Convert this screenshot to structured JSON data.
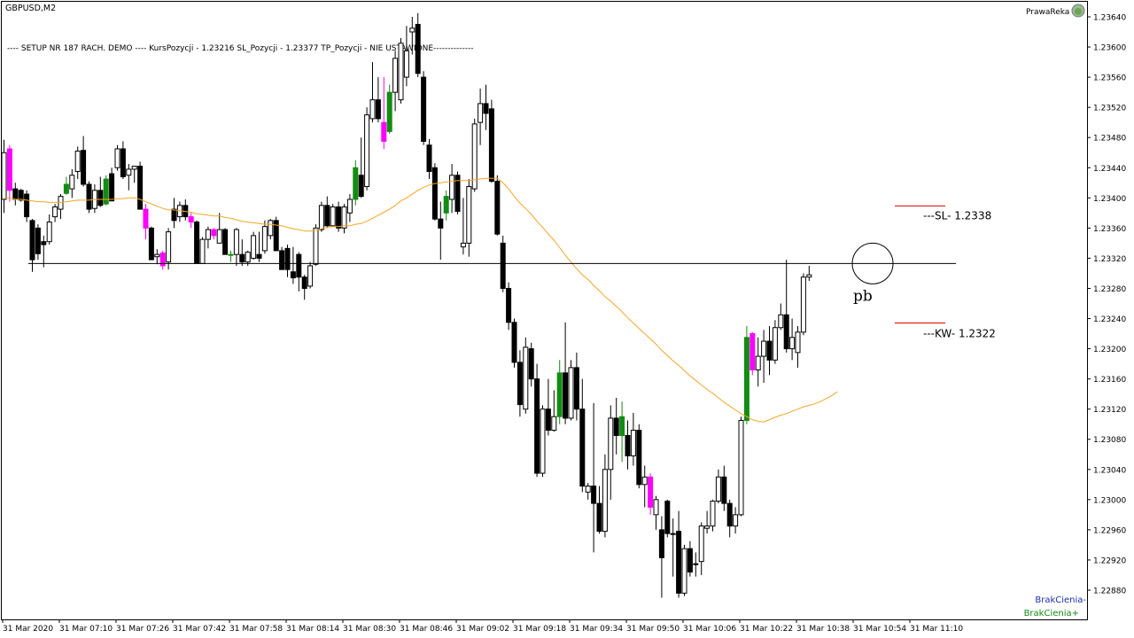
{
  "window": {
    "title": "GBPUSD,M2",
    "robot_name": "PrawaReka"
  },
  "chart_data": {
    "type": "candlestick",
    "symbol": "GBPUSD",
    "timeframe": "M2",
    "info_text": "---- SETUP NR 187 RACH. DEMO ---- KursPozycji - 1.23216 SL_Pozycji - 1.23377  TP_Pozycji - NIE USTAWIONE--------------",
    "y_ticks": [
      "1.23640",
      "1.23600",
      "1.23560",
      "1.23520",
      "1.23480",
      "1.23440",
      "1.23400",
      "1.23360",
      "1.23320",
      "1.23280",
      "1.23240",
      "1.23200",
      "1.23160",
      "1.23120",
      "1.23080",
      "1.23040",
      "1.23000",
      "1.22960",
      "1.22920",
      "1.22880"
    ],
    "ylim": [
      1.22865,
      1.23655
    ],
    "x_ticks": [
      "31 Mar 2020",
      "31 Mar 07:10",
      "31 Mar 07:26",
      "31 Mar 07:42",
      "31 Mar 07:58",
      "31 Mar 08:14",
      "31 Mar 08:30",
      "31 Mar 08:46",
      "31 Mar 09:02",
      "31 Mar 09:18",
      "31 Mar 09:34",
      "31 Mar 09:50",
      "31 Mar 10:06",
      "31 Mar 10:22",
      "31 Mar 10:38",
      "31 Mar 10:54",
      "31 Mar 11:10"
    ],
    "level_line": 1.23313,
    "sl_label": "---SL- 1.2338",
    "sl_level": 1.2338,
    "kw_label": "---KW- 1.2322",
    "kw_level": 1.2322,
    "annotation": "pb",
    "legend": {
      "line1": "BrakCienia-",
      "line2": "BrakCienia+"
    },
    "colors": {
      "bull": "#ffffff",
      "bear": "#000000",
      "outline": "#000000",
      "no_wick_down": "#ff00ff",
      "no_wick_up": "#128c12",
      "ma": "#f5a623",
      "sl_line": "#dd0000",
      "kw_line": "#dd0000",
      "legend_minus": "#1b2fae",
      "legend_plus": "#128c12"
    },
    "candles": [
      {
        "o": 1.23398,
        "h": 1.23477,
        "l": 1.2338,
        "c": 1.2346
      },
      {
        "o": 1.23465,
        "h": 1.2347,
        "l": 1.23395,
        "c": 1.2341
      },
      {
        "o": 1.23412,
        "h": 1.2342,
        "l": 1.2339,
        "c": 1.23398
      },
      {
        "o": 1.2341,
        "h": 1.23412,
        "l": 1.23395,
        "c": 1.23397
      },
      {
        "o": 1.23405,
        "h": 1.2341,
        "l": 1.23368,
        "c": 1.23375
      },
      {
        "o": 1.2337,
        "h": 1.23372,
        "l": 1.23302,
        "c": 1.23318
      },
      {
        "o": 1.2336,
        "h": 1.23365,
        "l": 1.23318,
        "c": 1.23326
      },
      {
        "o": 1.23342,
        "h": 1.2335,
        "l": 1.23308,
        "c": 1.23338
      },
      {
        "o": 1.23342,
        "h": 1.23378,
        "l": 1.23338,
        "c": 1.23368
      },
      {
        "o": 1.23375,
        "h": 1.23392,
        "l": 1.23368,
        "c": 1.23388
      },
      {
        "o": 1.23385,
        "h": 1.23405,
        "l": 1.23372,
        "c": 1.23402
      },
      {
        "o": 1.23406,
        "h": 1.23428,
        "l": 1.23404,
        "c": 1.23418
      },
      {
        "o": 1.23412,
        "h": 1.23438,
        "l": 1.234,
        "c": 1.2343
      },
      {
        "o": 1.23435,
        "h": 1.23468,
        "l": 1.23425,
        "c": 1.23462
      },
      {
        "o": 1.23463,
        "h": 1.23482,
        "l": 1.23415,
        "c": 1.23418
      },
      {
        "o": 1.23418,
        "h": 1.23422,
        "l": 1.2338,
        "c": 1.23385
      },
      {
        "o": 1.23386,
        "h": 1.23418,
        "l": 1.2338,
        "c": 1.2341
      },
      {
        "o": 1.2341,
        "h": 1.23428,
        "l": 1.23388,
        "c": 1.2339
      },
      {
        "o": 1.23392,
        "h": 1.2343,
        "l": 1.2339,
        "c": 1.23425
      },
      {
        "o": 1.23432,
        "h": 1.2344,
        "l": 1.23396,
        "c": 1.23396
      },
      {
        "o": 1.2344,
        "h": 1.2347,
        "l": 1.23436,
        "c": 1.23465
      },
      {
        "o": 1.23465,
        "h": 1.23475,
        "l": 1.23425,
        "c": 1.23428
      },
      {
        "o": 1.2343,
        "h": 1.23445,
        "l": 1.2341,
        "c": 1.23438
      },
      {
        "o": 1.23438,
        "h": 1.23442,
        "l": 1.2342,
        "c": 1.23442
      },
      {
        "o": 1.23442,
        "h": 1.23448,
        "l": 1.23385,
        "c": 1.23385
      },
      {
        "o": 1.23385,
        "h": 1.23392,
        "l": 1.23345,
        "c": 1.2336
      },
      {
        "o": 1.2336,
        "h": 1.23362,
        "l": 1.23318,
        "c": 1.23318
      },
      {
        "o": 1.23322,
        "h": 1.23332,
        "l": 1.23312,
        "c": 1.23325
      },
      {
        "o": 1.23327,
        "h": 1.2333,
        "l": 1.23305,
        "c": 1.2331
      },
      {
        "o": 1.23315,
        "h": 1.2336,
        "l": 1.23305,
        "c": 1.23355
      },
      {
        "o": 1.23385,
        "h": 1.234,
        "l": 1.2336,
        "c": 1.2337
      },
      {
        "o": 1.23375,
        "h": 1.23395,
        "l": 1.23368,
        "c": 1.2339
      },
      {
        "o": 1.2339,
        "h": 1.23398,
        "l": 1.2337,
        "c": 1.23375
      },
      {
        "o": 1.23375,
        "h": 1.2338,
        "l": 1.2336,
        "c": 1.23368
      },
      {
        "o": 1.23368,
        "h": 1.2337,
        "l": 1.23313,
        "c": 1.23313
      },
      {
        "o": 1.23313,
        "h": 1.23348,
        "l": 1.23313,
        "c": 1.23345
      },
      {
        "o": 1.23345,
        "h": 1.23362,
        "l": 1.23333,
        "c": 1.23358
      },
      {
        "o": 1.23358,
        "h": 1.2336,
        "l": 1.23345,
        "c": 1.2335
      },
      {
        "o": 1.2334,
        "h": 1.2338,
        "l": 1.2334,
        "c": 1.23358
      },
      {
        "o": 1.23358,
        "h": 1.2336,
        "l": 1.23325,
        "c": 1.23325
      },
      {
        "o": 1.23325,
        "h": 1.2333,
        "l": 1.23315,
        "c": 1.23325
      },
      {
        "o": 1.23325,
        "h": 1.2336,
        "l": 1.2331,
        "c": 1.23358
      },
      {
        "o": 1.23325,
        "h": 1.23345,
        "l": 1.2331,
        "c": 1.23315
      },
      {
        "o": 1.23315,
        "h": 1.2333,
        "l": 1.2331,
        "c": 1.23328
      },
      {
        "o": 1.2332,
        "h": 1.23355,
        "l": 1.23318,
        "c": 1.2335
      },
      {
        "o": 1.23325,
        "h": 1.23355,
        "l": 1.23315,
        "c": 1.2332
      },
      {
        "o": 1.2333,
        "h": 1.2337,
        "l": 1.23326,
        "c": 1.23362
      },
      {
        "o": 1.2335,
        "h": 1.23372,
        "l": 1.23345,
        "c": 1.2337
      },
      {
        "o": 1.2337,
        "h": 1.23375,
        "l": 1.2333,
        "c": 1.2333
      },
      {
        "o": 1.2333,
        "h": 1.23335,
        "l": 1.23305,
        "c": 1.23305
      },
      {
        "o": 1.23333,
        "h": 1.23338,
        "l": 1.23295,
        "c": 1.23305
      },
      {
        "o": 1.23302,
        "h": 1.23335,
        "l": 1.23286,
        "c": 1.23294
      },
      {
        "o": 1.23325,
        "h": 1.23328,
        "l": 1.23276,
        "c": 1.23295
      },
      {
        "o": 1.23295,
        "h": 1.23298,
        "l": 1.23265,
        "c": 1.2328
      },
      {
        "o": 1.23283,
        "h": 1.23315,
        "l": 1.2328,
        "c": 1.2331
      },
      {
        "o": 1.23312,
        "h": 1.23365,
        "l": 1.2331,
        "c": 1.2336
      },
      {
        "o": 1.23358,
        "h": 1.23395,
        "l": 1.23355,
        "c": 1.2339
      },
      {
        "o": 1.2339,
        "h": 1.23402,
        "l": 1.2336,
        "c": 1.23363
      },
      {
        "o": 1.23363,
        "h": 1.23392,
        "l": 1.23362,
        "c": 1.23388
      },
      {
        "o": 1.23388,
        "h": 1.23395,
        "l": 1.23355,
        "c": 1.2336
      },
      {
        "o": 1.2336,
        "h": 1.23392,
        "l": 1.23353,
        "c": 1.23388
      },
      {
        "o": 1.2338,
        "h": 1.23405,
        "l": 1.23368,
        "c": 1.23398
      },
      {
        "o": 1.23398,
        "h": 1.2345,
        "l": 1.2339,
        "c": 1.2344
      },
      {
        "o": 1.2343,
        "h": 1.2348,
        "l": 1.234,
        "c": 1.23402
      },
      {
        "o": 1.23415,
        "h": 1.2352,
        "l": 1.2341,
        "c": 1.2351
      },
      {
        "o": 1.23505,
        "h": 1.2358,
        "l": 1.235,
        "c": 1.2353
      },
      {
        "o": 1.2353,
        "h": 1.2356,
        "l": 1.235,
        "c": 1.23505
      },
      {
        "o": 1.235,
        "h": 1.2356,
        "l": 1.23465,
        "c": 1.23475
      },
      {
        "o": 1.23488,
        "h": 1.2355,
        "l": 1.23485,
        "c": 1.2354
      },
      {
        "o": 1.2354,
        "h": 1.23595,
        "l": 1.23515,
        "c": 1.23585
      },
      {
        "o": 1.2353,
        "h": 1.23612,
        "l": 1.23525,
        "c": 1.23605
      },
      {
        "o": 1.2356,
        "h": 1.23628,
        "l": 1.23548,
        "c": 1.23595
      },
      {
        "o": 1.2362,
        "h": 1.2364,
        "l": 1.2359,
        "c": 1.23625
      },
      {
        "o": 1.2363,
        "h": 1.23645,
        "l": 1.2356,
        "c": 1.23565
      },
      {
        "o": 1.2356,
        "h": 1.23568,
        "l": 1.2347,
        "c": 1.23475
      },
      {
        "o": 1.2347,
        "h": 1.23478,
        "l": 1.23425,
        "c": 1.23435
      },
      {
        "o": 1.2344,
        "h": 1.23446,
        "l": 1.2337,
        "c": 1.23372
      },
      {
        "o": 1.23372,
        "h": 1.23395,
        "l": 1.23318,
        "c": 1.2336
      },
      {
        "o": 1.2338,
        "h": 1.2341,
        "l": 1.2337,
        "c": 1.23402
      },
      {
        "o": 1.23398,
        "h": 1.23445,
        "l": 1.2338,
        "c": 1.2343
      },
      {
        "o": 1.2343,
        "h": 1.23435,
        "l": 1.23378,
        "c": 1.23382
      },
      {
        "o": 1.23335,
        "h": 1.234,
        "l": 1.23325,
        "c": 1.2334
      },
      {
        "o": 1.2334,
        "h": 1.23425,
        "l": 1.23322,
        "c": 1.23415
      },
      {
        "o": 1.23412,
        "h": 1.23505,
        "l": 1.23408,
        "c": 1.23498
      },
      {
        "o": 1.235,
        "h": 1.23545,
        "l": 1.2347,
        "c": 1.23525
      },
      {
        "o": 1.23525,
        "h": 1.2355,
        "l": 1.2349,
        "c": 1.23512
      },
      {
        "o": 1.23518,
        "h": 1.2353,
        "l": 1.2342,
        "c": 1.23422
      },
      {
        "o": 1.23422,
        "h": 1.2343,
        "l": 1.2335,
        "c": 1.23352
      },
      {
        "o": 1.2334,
        "h": 1.2335,
        "l": 1.23275,
        "c": 1.2328
      },
      {
        "o": 1.2328,
        "h": 1.23288,
        "l": 1.23225,
        "c": 1.23235
      },
      {
        "o": 1.23235,
        "h": 1.2324,
        "l": 1.23175,
        "c": 1.23182
      },
      {
        "o": 1.23182,
        "h": 1.23198,
        "l": 1.2311,
        "c": 1.23126
      },
      {
        "o": 1.2312,
        "h": 1.23215,
        "l": 1.23114,
        "c": 1.23202
      },
      {
        "o": 1.232,
        "h": 1.23208,
        "l": 1.2315,
        "c": 1.2316
      },
      {
        "o": 1.2316,
        "h": 1.2318,
        "l": 1.2303,
        "c": 1.23035
      },
      {
        "o": 1.23035,
        "h": 1.23125,
        "l": 1.2303,
        "c": 1.2312
      },
      {
        "o": 1.2312,
        "h": 1.2316,
        "l": 1.23085,
        "c": 1.23092
      },
      {
        "o": 1.23092,
        "h": 1.23145,
        "l": 1.2309,
        "c": 1.2311
      },
      {
        "o": 1.2311,
        "h": 1.23185,
        "l": 1.231,
        "c": 1.23168
      },
      {
        "o": 1.23168,
        "h": 1.23235,
        "l": 1.231,
        "c": 1.23108
      },
      {
        "o": 1.23108,
        "h": 1.23185,
        "l": 1.23105,
        "c": 1.23175
      },
      {
        "o": 1.23175,
        "h": 1.23195,
        "l": 1.23105,
        "c": 1.2312
      },
      {
        "o": 1.2312,
        "h": 1.2316,
        "l": 1.2301,
        "c": 1.23018
      },
      {
        "o": 1.2301,
        "h": 1.23022,
        "l": 1.23,
        "c": 1.23018
      },
      {
        "o": 1.23018,
        "h": 1.23128,
        "l": 1.2293,
        "c": 1.22995
      },
      {
        "o": 1.22995,
        "h": 1.23018,
        "l": 1.22955,
        "c": 1.22958
      },
      {
        "o": 1.22958,
        "h": 1.2306,
        "l": 1.2295,
        "c": 1.2304
      },
      {
        "o": 1.2304,
        "h": 1.23125,
        "l": 1.23,
        "c": 1.23108
      },
      {
        "o": 1.23108,
        "h": 1.23135,
        "l": 1.2306,
        "c": 1.23085
      },
      {
        "o": 1.23085,
        "h": 1.2313,
        "l": 1.2305,
        "c": 1.2311
      },
      {
        "o": 1.23085,
        "h": 1.23105,
        "l": 1.2304,
        "c": 1.23058
      },
      {
        "o": 1.23058,
        "h": 1.23115,
        "l": 1.23045,
        "c": 1.23092
      },
      {
        "o": 1.23092,
        "h": 1.231,
        "l": 1.23015,
        "c": 1.2302
      },
      {
        "o": 1.2302,
        "h": 1.23045,
        "l": 1.2299,
        "c": 1.2303
      },
      {
        "o": 1.2303,
        "h": 1.23035,
        "l": 1.2298,
        "c": 1.2299
      },
      {
        "o": 1.2298,
        "h": 1.23005,
        "l": 1.2296,
        "c": 1.23
      },
      {
        "o": 1.2296,
        "h": 1.22978,
        "l": 1.2287,
        "c": 1.22923
      },
      {
        "o": 1.22998,
        "h": 1.23,
        "l": 1.2295,
        "c": 1.22955
      },
      {
        "o": 1.22955,
        "h": 1.22975,
        "l": 1.22898,
        "c": 1.22955
      },
      {
        "o": 1.22958,
        "h": 1.22985,
        "l": 1.2287,
        "c": 1.22876
      },
      {
        "o": 1.22876,
        "h": 1.2294,
        "l": 1.22872,
        "c": 1.22935
      },
      {
        "o": 1.22935,
        "h": 1.22945,
        "l": 1.22898,
        "c": 1.22904
      },
      {
        "o": 1.22915,
        "h": 1.2293,
        "l": 1.22898,
        "c": 1.22915
      },
      {
        "o": 1.22918,
        "h": 1.2297,
        "l": 1.229,
        "c": 1.22965
      },
      {
        "o": 1.22962,
        "h": 1.22985,
        "l": 1.22955,
        "c": 1.22965
      },
      {
        "o": 1.22965,
        "h": 1.23,
        "l": 1.22958,
        "c": 1.22998
      },
      {
        "o": 1.22998,
        "h": 1.2304,
        "l": 1.22995,
        "c": 1.2303
      },
      {
        "o": 1.2303,
        "h": 1.23045,
        "l": 1.22985,
        "c": 1.22995
      },
      {
        "o": 1.22995,
        "h": 1.23,
        "l": 1.2295,
        "c": 1.22965
      },
      {
        "o": 1.22965,
        "h": 1.2299,
        "l": 1.22955,
        "c": 1.2298
      },
      {
        "o": 1.2298,
        "h": 1.2311,
        "l": 1.22978,
        "c": 1.23105
      },
      {
        "o": 1.23105,
        "h": 1.2323,
        "l": 1.231,
        "c": 1.23215
      },
      {
        "o": 1.2322,
        "h": 1.23222,
        "l": 1.23165,
        "c": 1.23172
      },
      {
        "o": 1.23172,
        "h": 1.23215,
        "l": 1.2315,
        "c": 1.2319
      },
      {
        "o": 1.2319,
        "h": 1.23225,
        "l": 1.23155,
        "c": 1.2321
      },
      {
        "o": 1.2321,
        "h": 1.2323,
        "l": 1.23165,
        "c": 1.23185
      },
      {
        "o": 1.23185,
        "h": 1.23238,
        "l": 1.2318,
        "c": 1.23228
      },
      {
        "o": 1.23228,
        "h": 1.2326,
        "l": 1.23225,
        "c": 1.23245
      },
      {
        "o": 1.23245,
        "h": 1.23318,
        "l": 1.23195,
        "c": 1.232
      },
      {
        "o": 1.232,
        "h": 1.2324,
        "l": 1.23185,
        "c": 1.23215
      },
      {
        "o": 1.23195,
        "h": 1.2323,
        "l": 1.23175,
        "c": 1.23222
      },
      {
        "o": 1.23222,
        "h": 1.233,
        "l": 1.23218,
        "c": 1.23295
      },
      {
        "o": 1.23295,
        "h": 1.2331,
        "l": 1.2329,
        "c": 1.23298
      }
    ],
    "ma": [
      1.234,
      1.234,
      1.23398,
      1.23398,
      1.23397,
      1.23396,
      1.23395,
      1.23395,
      1.23394,
      1.23394,
      1.23394,
      1.23395,
      1.23396,
      1.23397,
      1.23397,
      1.23397,
      1.23398,
      1.23398,
      1.23398,
      1.23398,
      1.23399,
      1.23399,
      1.234,
      1.234,
      1.23398,
      1.23395,
      1.23392,
      1.23389,
      1.23386,
      1.23384,
      1.23384,
      1.23383,
      1.23382,
      1.23381,
      1.23379,
      1.23378,
      1.23377,
      1.23376,
      1.23376,
      1.23374,
      1.23373,
      1.23371,
      1.23369,
      1.23368,
      1.23367,
      1.23366,
      1.23365,
      1.23365,
      1.23364,
      1.23363,
      1.23361,
      1.23359,
      1.23358,
      1.23356,
      1.23356,
      1.23357,
      1.23359,
      1.23361,
      1.23362,
      1.23362,
      1.23363,
      1.23363,
      1.23365,
      1.23366,
      1.23369,
      1.23373,
      1.23377,
      1.23381,
      1.23385,
      1.2339,
      1.23396,
      1.234,
      1.23405,
      1.2341,
      1.23414,
      1.23417,
      1.23419,
      1.2342,
      1.23421,
      1.23422,
      1.23423,
      1.23423,
      1.23423,
      1.23424,
      1.23425,
      1.23426,
      1.23426,
      1.23426,
      1.2342,
      1.23412,
      1.23402,
      1.23393,
      1.23386,
      1.23378,
      1.23369,
      1.23361,
      1.23352,
      1.23344,
      1.23334,
      1.23324,
      1.23315,
      1.23306,
      1.23298,
      1.23292,
      1.23284,
      1.23277,
      1.23269,
      1.23263,
      1.23256,
      1.23249,
      1.23241,
      1.23234,
      1.23227,
      1.2322,
      1.23213,
      1.23206,
      1.23198,
      1.23191,
      1.23184,
      1.23178,
      1.23171,
      1.23164,
      1.23158,
      1.23152,
      1.23146,
      1.23141,
      1.23135,
      1.23129,
      1.23124,
      1.23119,
      1.23114,
      1.2311,
      1.23106,
      1.23104,
      1.23103,
      1.23106,
      1.23109,
      1.23112,
      1.23114,
      1.23117,
      1.2312,
      1.23123,
      1.23125,
      1.23127,
      1.2313,
      1.23134,
      1.23138,
      1.23143
    ],
    "no_wick_down_indices": [
      1,
      20,
      25,
      28,
      33,
      37,
      56,
      61,
      62,
      67,
      70,
      114,
      132,
      136,
      139,
      147,
      149,
      163
    ],
    "no_wick_up_indices": [
      11,
      18,
      33,
      40,
      45,
      50,
      62,
      68,
      73,
      76,
      78,
      87,
      98,
      109,
      131
    ]
  }
}
